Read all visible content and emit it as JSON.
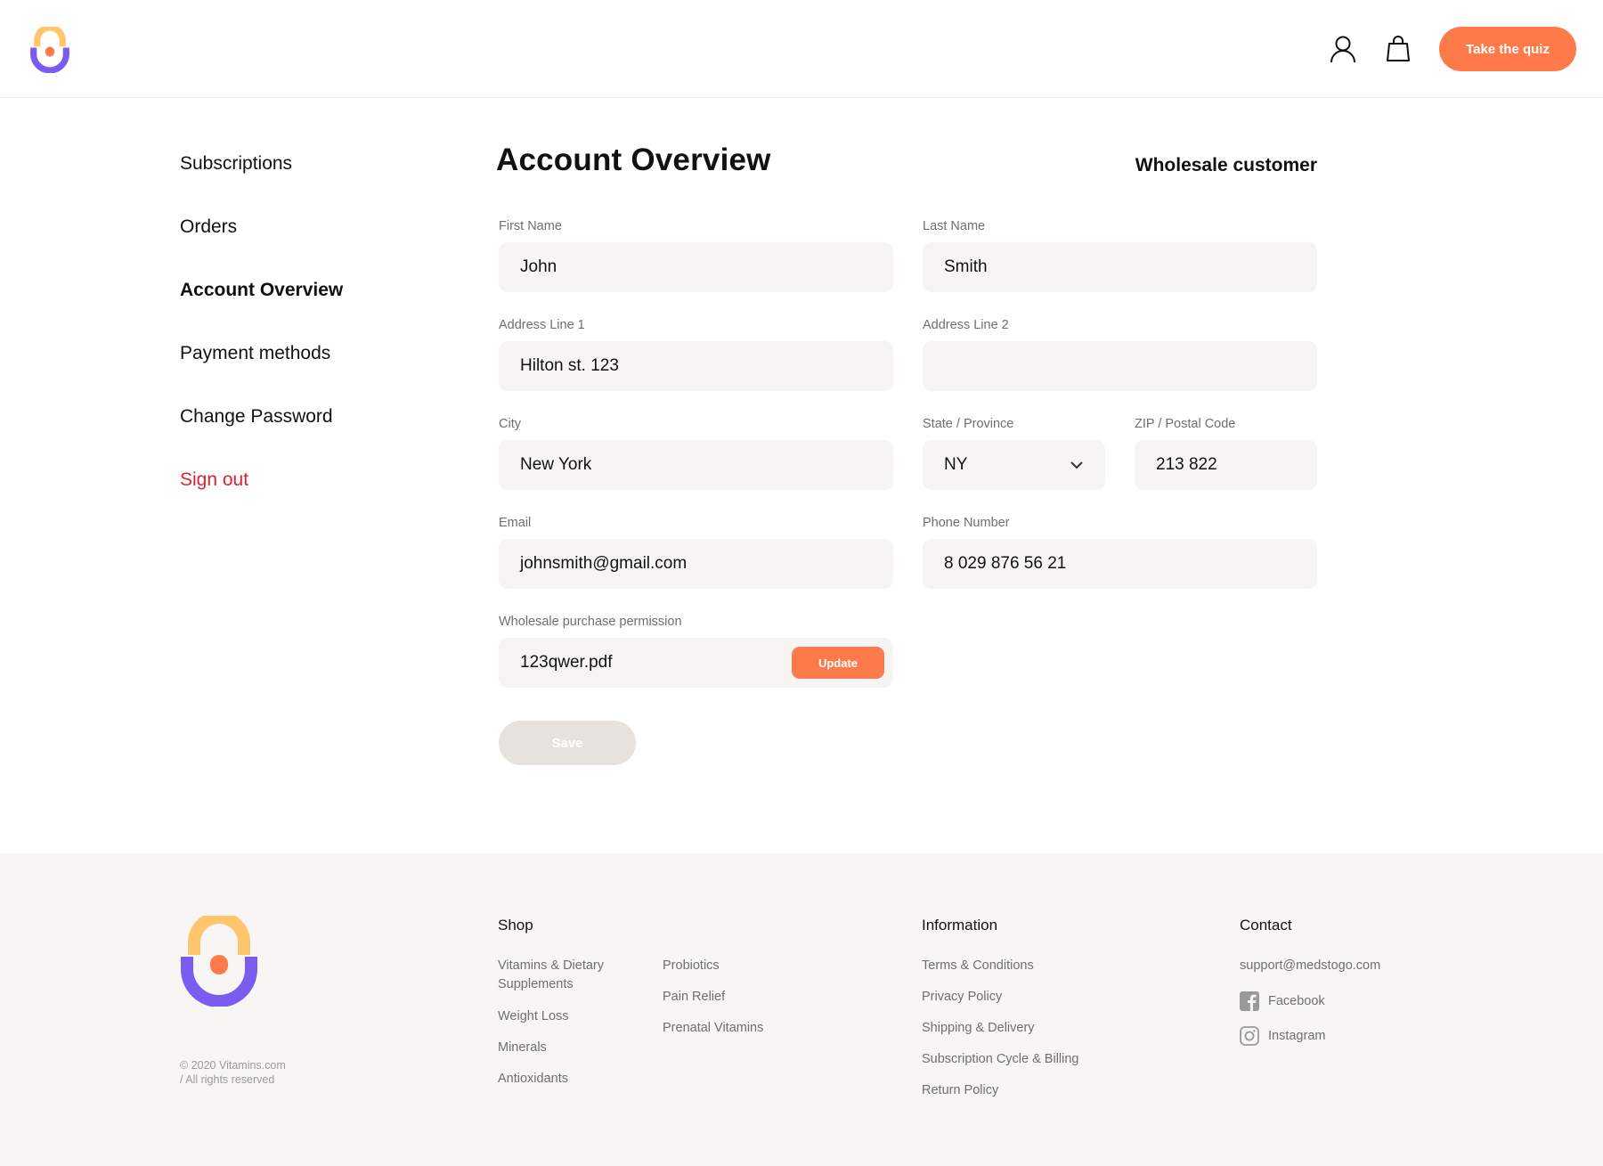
{
  "header": {
    "quiz_label": "Take the quiz",
    "icons": [
      "user-icon",
      "bag-icon"
    ]
  },
  "sidebar": {
    "items": [
      {
        "label": "Subscriptions"
      },
      {
        "label": "Orders"
      },
      {
        "label": "Account Overview",
        "active": true
      },
      {
        "label": "Payment methods"
      },
      {
        "label": "Change Password"
      },
      {
        "label": "Sign out",
        "color": "#e0202e"
      }
    ]
  },
  "main": {
    "title": "Account Overview",
    "customer_type": "Wholesale customer",
    "fields": {
      "first_name": {
        "label": "First Name",
        "value": "John"
      },
      "last_name": {
        "label": "Last Name",
        "value": "Smith"
      },
      "address1": {
        "label": "Address Line 1",
        "value": "Hilton st. 123"
      },
      "address2": {
        "label": "Address Line 2",
        "value": ""
      },
      "city": {
        "label": "City",
        "value": "New York"
      },
      "state": {
        "label": "State / Province",
        "value": "NY"
      },
      "zip": {
        "label": "ZIP / Postal Code",
        "value": "213 822"
      },
      "email": {
        "label": "Email",
        "value": "johnsmith@gmail.com"
      },
      "phone": {
        "label": "Phone Number",
        "value": "8 029 876 56 21"
      },
      "permission": {
        "label": "Wholesale purchase permission",
        "value": "123qwer.pdf",
        "button": "Update"
      }
    },
    "save_label": "Save"
  },
  "footer": {
    "copyright_line1": "© 2020 Vitamins.com",
    "copyright_line2": "/ All rights reserved",
    "shop": {
      "heading": "Shop",
      "col1": [
        "Vitamins & Dietary Supplements",
        "Weight Loss",
        "Minerals",
        "Antioxidants"
      ],
      "col2": [
        "Probiotics",
        "Pain Relief",
        "Prenatal Vitamins"
      ]
    },
    "information": {
      "heading": "Information",
      "links": [
        "Terms & Conditions",
        "Privacy Policy",
        "Shipping & Delivery",
        "Subscription Cycle & Billing",
        "Return Policy"
      ]
    },
    "contact": {
      "heading": "Contact",
      "email": "support@medstogo.com",
      "facebook": "Facebook",
      "instagram": "Instagram"
    }
  },
  "colors": {
    "accent": "#ff7a4a",
    "logo_purple": "#7b5cf0",
    "logo_yellow": "#ffc56b",
    "danger": "#e0202e",
    "input_bg": "#f6f5f3"
  }
}
